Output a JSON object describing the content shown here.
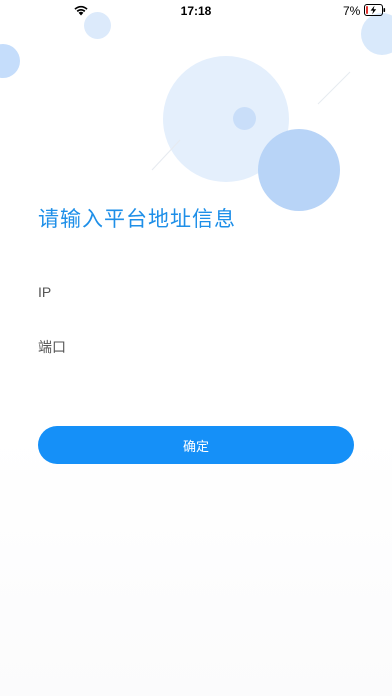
{
  "status_bar": {
    "time": "17:18",
    "battery_percent": "7%",
    "wifi_icon": "wifi-icon",
    "battery_icon": "battery-charging-icon"
  },
  "form": {
    "title": "请输入平台地址信息",
    "ip_placeholder": "IP",
    "port_placeholder": "端口",
    "confirm_label": "确定"
  },
  "colors": {
    "accent": "#1590f8",
    "title": "#1e8fe8",
    "bubble_light": "#e4effc",
    "bubble_mid": "#b8d4f7"
  }
}
